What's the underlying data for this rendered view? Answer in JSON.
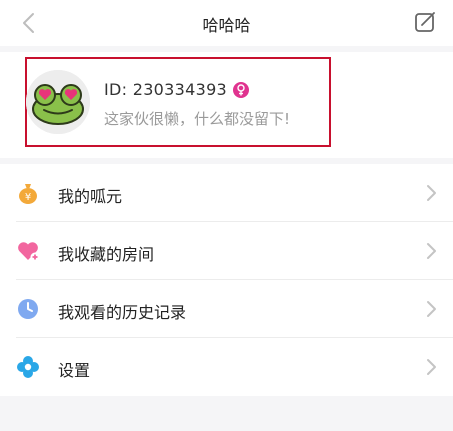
{
  "nav": {
    "title": "哈哈哈",
    "back_icon": "chevron-left-icon",
    "edit_icon": "edit-icon"
  },
  "profile": {
    "id_text": "ID: 230334393",
    "gender_icon": "female-icon",
    "bio": "这家伙很懒，什么都没留下!",
    "highlight_color": "#c8102e",
    "gender_color": "#e0338f"
  },
  "menu": {
    "items": [
      {
        "label": "我的呱元",
        "icon": "money-bag-icon",
        "color": "#f3a93a"
      },
      {
        "label": "我收藏的房间",
        "icon": "heart-plus-icon",
        "color": "#f2669f"
      },
      {
        "label": "我观看的历史记录",
        "icon": "clock-icon",
        "color": "#7fa9f0"
      },
      {
        "label": "设置",
        "icon": "gear-icon",
        "color": "#2aa7e7"
      }
    ]
  }
}
